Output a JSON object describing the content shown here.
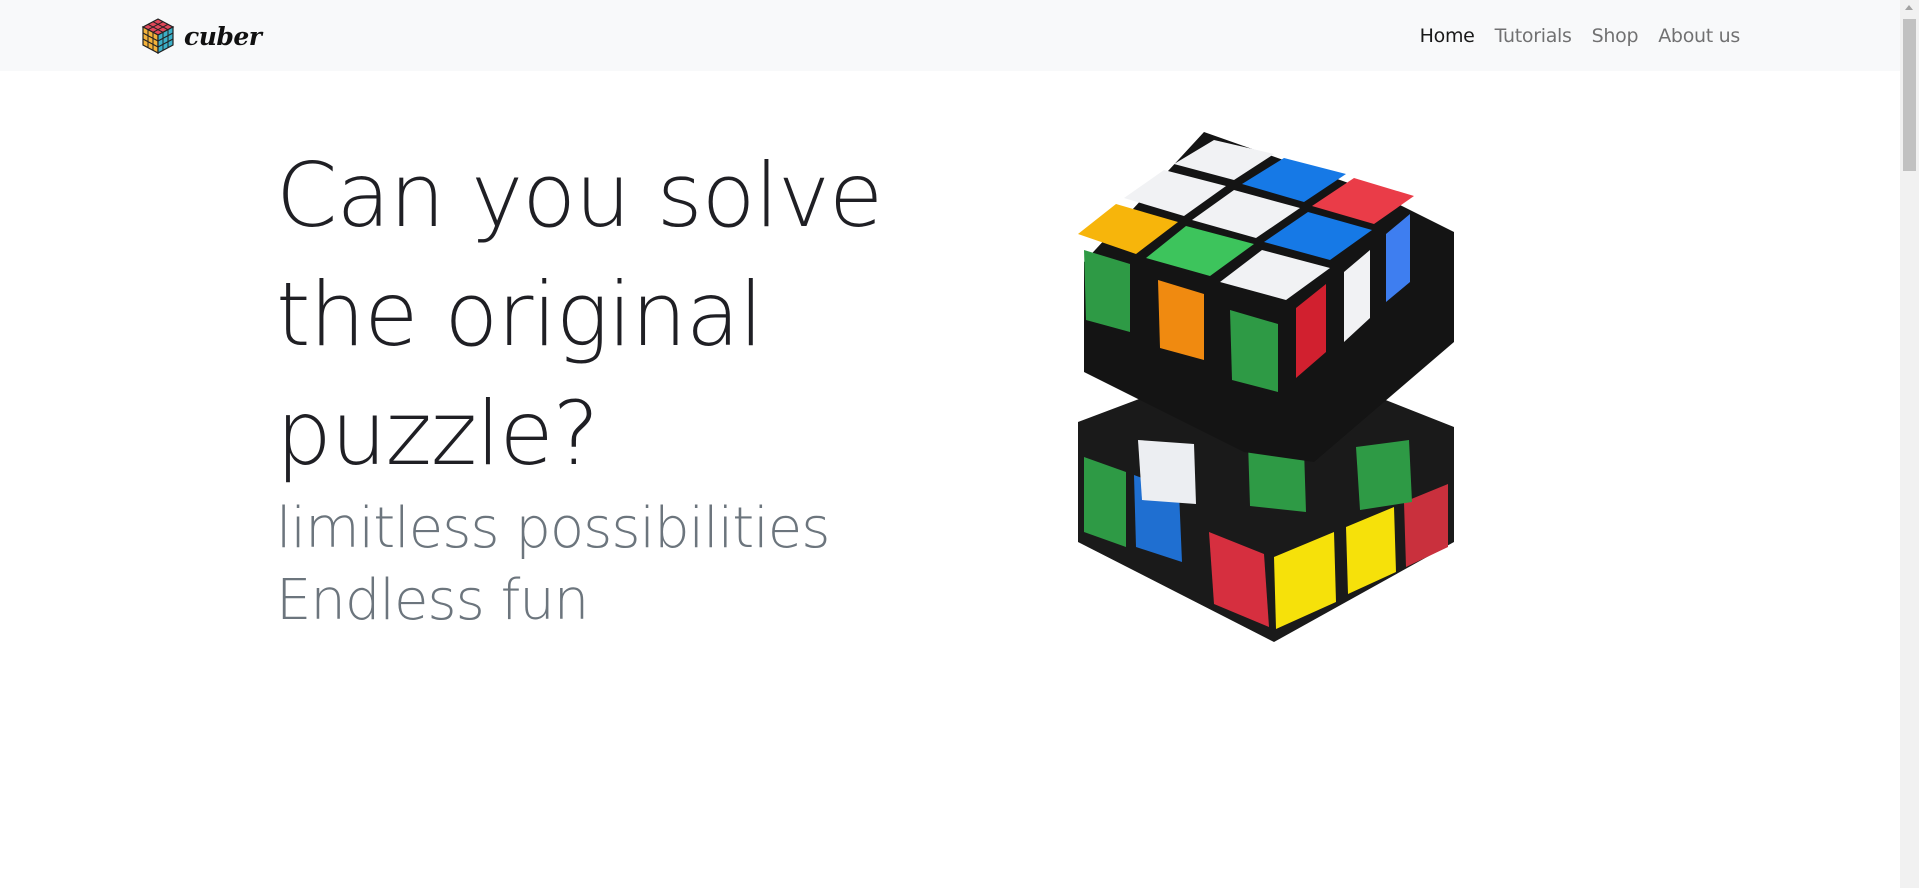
{
  "brand": {
    "name": "cuber",
    "logo_icon": "rubiks-cube-logo-icon"
  },
  "nav": {
    "items": [
      {
        "label": "Home",
        "active": true
      },
      {
        "label": "Tutorials",
        "active": false
      },
      {
        "label": "Shop",
        "active": false
      },
      {
        "label": "About us",
        "active": false
      }
    ]
  },
  "hero": {
    "title_lines": [
      "Can you solve",
      "the original",
      "puzzle?"
    ],
    "sub_lines": [
      "limitless possibilities",
      "Endless fun"
    ],
    "image_icon": "rubiks-cube-image"
  },
  "colors": {
    "navbar_bg": "#f8f9fa",
    "title": "#1f1f24",
    "subtitle": "#6c757d",
    "nav_link": "rgba(0,0,0,0.55)",
    "nav_active": "rgba(0,0,0,0.9)"
  }
}
